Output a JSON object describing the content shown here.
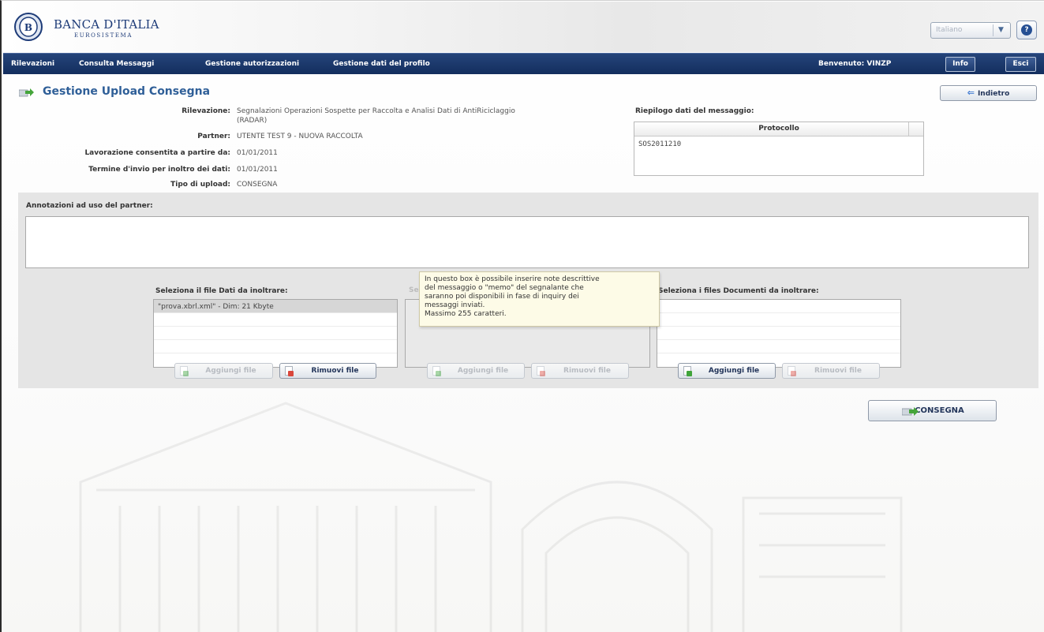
{
  "header": {
    "bank_name": "BANCA D'ITALIA",
    "bank_sub": "EUROSISTEMA",
    "language": "Italiano",
    "help_icon": "question-icon"
  },
  "nav": {
    "items": [
      "Rilevazioni",
      "Consulta Messaggi",
      "Gestione autorizzazioni",
      "Gestione dati del profilo"
    ],
    "welcome": "Benvenuto:  VINZP",
    "info": "Info",
    "exit": "Esci"
  },
  "page": {
    "title": "Gestione Upload Consegna",
    "back": "Indietro"
  },
  "fields": {
    "rilevazione_label": "Rilevazione:",
    "rilevazione_value_1": "Segnalazioni Operazioni Sospette per Raccolta e Analisi Dati di AntiRiciclaggio",
    "rilevazione_value_2": "(RADAR)",
    "partner_label": "Partner:",
    "partner_value": "UTENTE TEST 9 - NUOVA RACCOLTA",
    "lavorazione_label": "Lavorazione consentita a partire da:",
    "lavorazione_value": "01/01/2011",
    "termine_label": "Termine d'invio per inoltro dei dati:",
    "termine_value": "01/01/2011",
    "tipo_label": "Tipo di upload:",
    "tipo_value": "CONSEGNA"
  },
  "riepilogo": {
    "label": "Riepilogo dati del messaggio:",
    "column": "Protocollo",
    "value": "SOS2011210"
  },
  "annotazioni": {
    "label": "Annotazioni ad uso del partner:"
  },
  "tooltip": {
    "lines": [
      "In questo box è possibile inserire note descrittive",
      "del messaggio o \"memo\" del segnalante che",
      "saranno poi disponibili in fase di inquiry dei",
      "messaggi inviati.",
      "Massimo 255 caratteri."
    ]
  },
  "files": {
    "dati_label": "Seleziona il file Dati da inoltrare:",
    "dati_selected": "\"prova.xbrl.xml\" - Dim: 21 Kbyte",
    "hidden_label": "Se",
    "documenti_label": "Seleziona i files Documenti da inoltrare:",
    "add": "Aggiungi file",
    "remove": "Rimuovi file"
  },
  "actions": {
    "consegna": "CONSEGNA"
  },
  "colors": {
    "navbar": "#1b3868",
    "title": "#2f5f98",
    "panel": "#e5e5e5",
    "tooltip": "#fdfbe7"
  }
}
